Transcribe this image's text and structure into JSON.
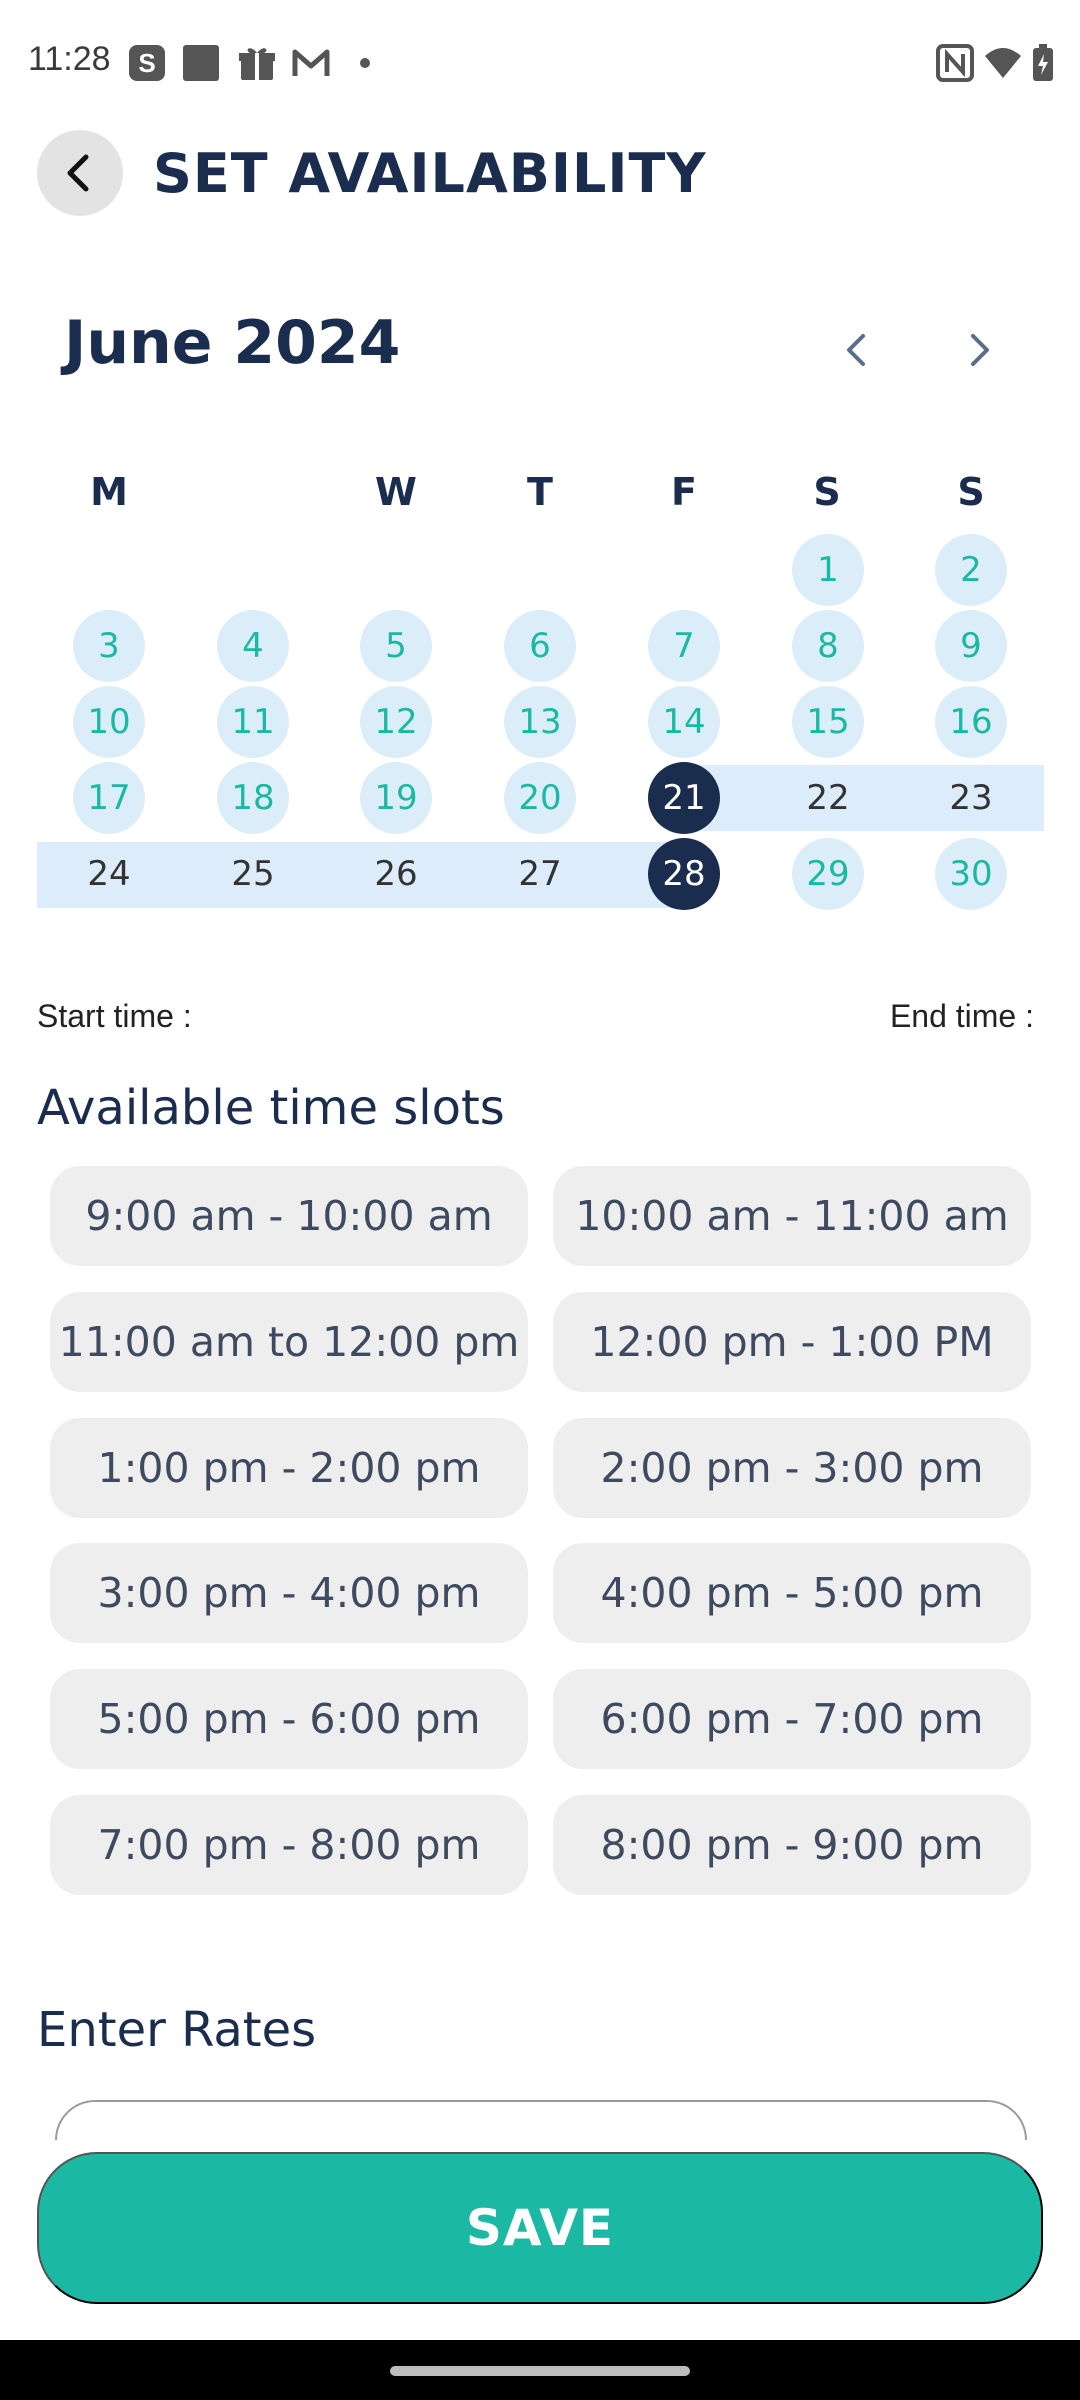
{
  "status_bar": {
    "time": "11:28",
    "icons": [
      "s-app-icon",
      "square-icon",
      "gift-icon",
      "gmail-icon",
      "dot-icon",
      "nfc-icon",
      "wifi-icon",
      "battery-icon"
    ]
  },
  "header": {
    "title": "SET AVAILABILITY",
    "back_icon": "chevron-left-icon"
  },
  "calendar": {
    "month_label": "June 2024",
    "weekdays": [
      "M",
      "",
      "W",
      "T",
      "F",
      "S",
      "S"
    ],
    "days": [
      "1",
      "2",
      "3",
      "4",
      "5",
      "6",
      "7",
      "8",
      "9",
      "10",
      "11",
      "12",
      "13",
      "14",
      "15",
      "16",
      "17",
      "18",
      "19",
      "20",
      "21",
      "22",
      "23",
      "24",
      "25",
      "26",
      "27",
      "28",
      "29",
      "30"
    ],
    "range_start": "21",
    "range_end": "28"
  },
  "times": {
    "start_label": "Start time :",
    "end_label": "End time :"
  },
  "slots_section": {
    "title": "Available time slots",
    "slots": [
      "9:00 am - 10:00 am",
      "10:00 am - 11:00 am",
      "11:00 am to 12:00 pm",
      "12:00 pm - 1:00 PM",
      "1:00 pm - 2:00 pm",
      "2:00 pm - 3:00 pm",
      "3:00 pm - 4:00 pm",
      "4:00 pm - 5:00 pm",
      "5:00 pm - 6:00 pm",
      "6:00 pm - 7:00 pm",
      "7:00 pm - 8:00 pm",
      "8:00 pm - 9:00 pm"
    ]
  },
  "rates": {
    "title": "Enter Rates"
  },
  "actions": {
    "save_label": "SAVE"
  },
  "colors": {
    "primary": "#1bb9a3",
    "navy": "#1b2d4f",
    "range": "#dcecfa"
  }
}
